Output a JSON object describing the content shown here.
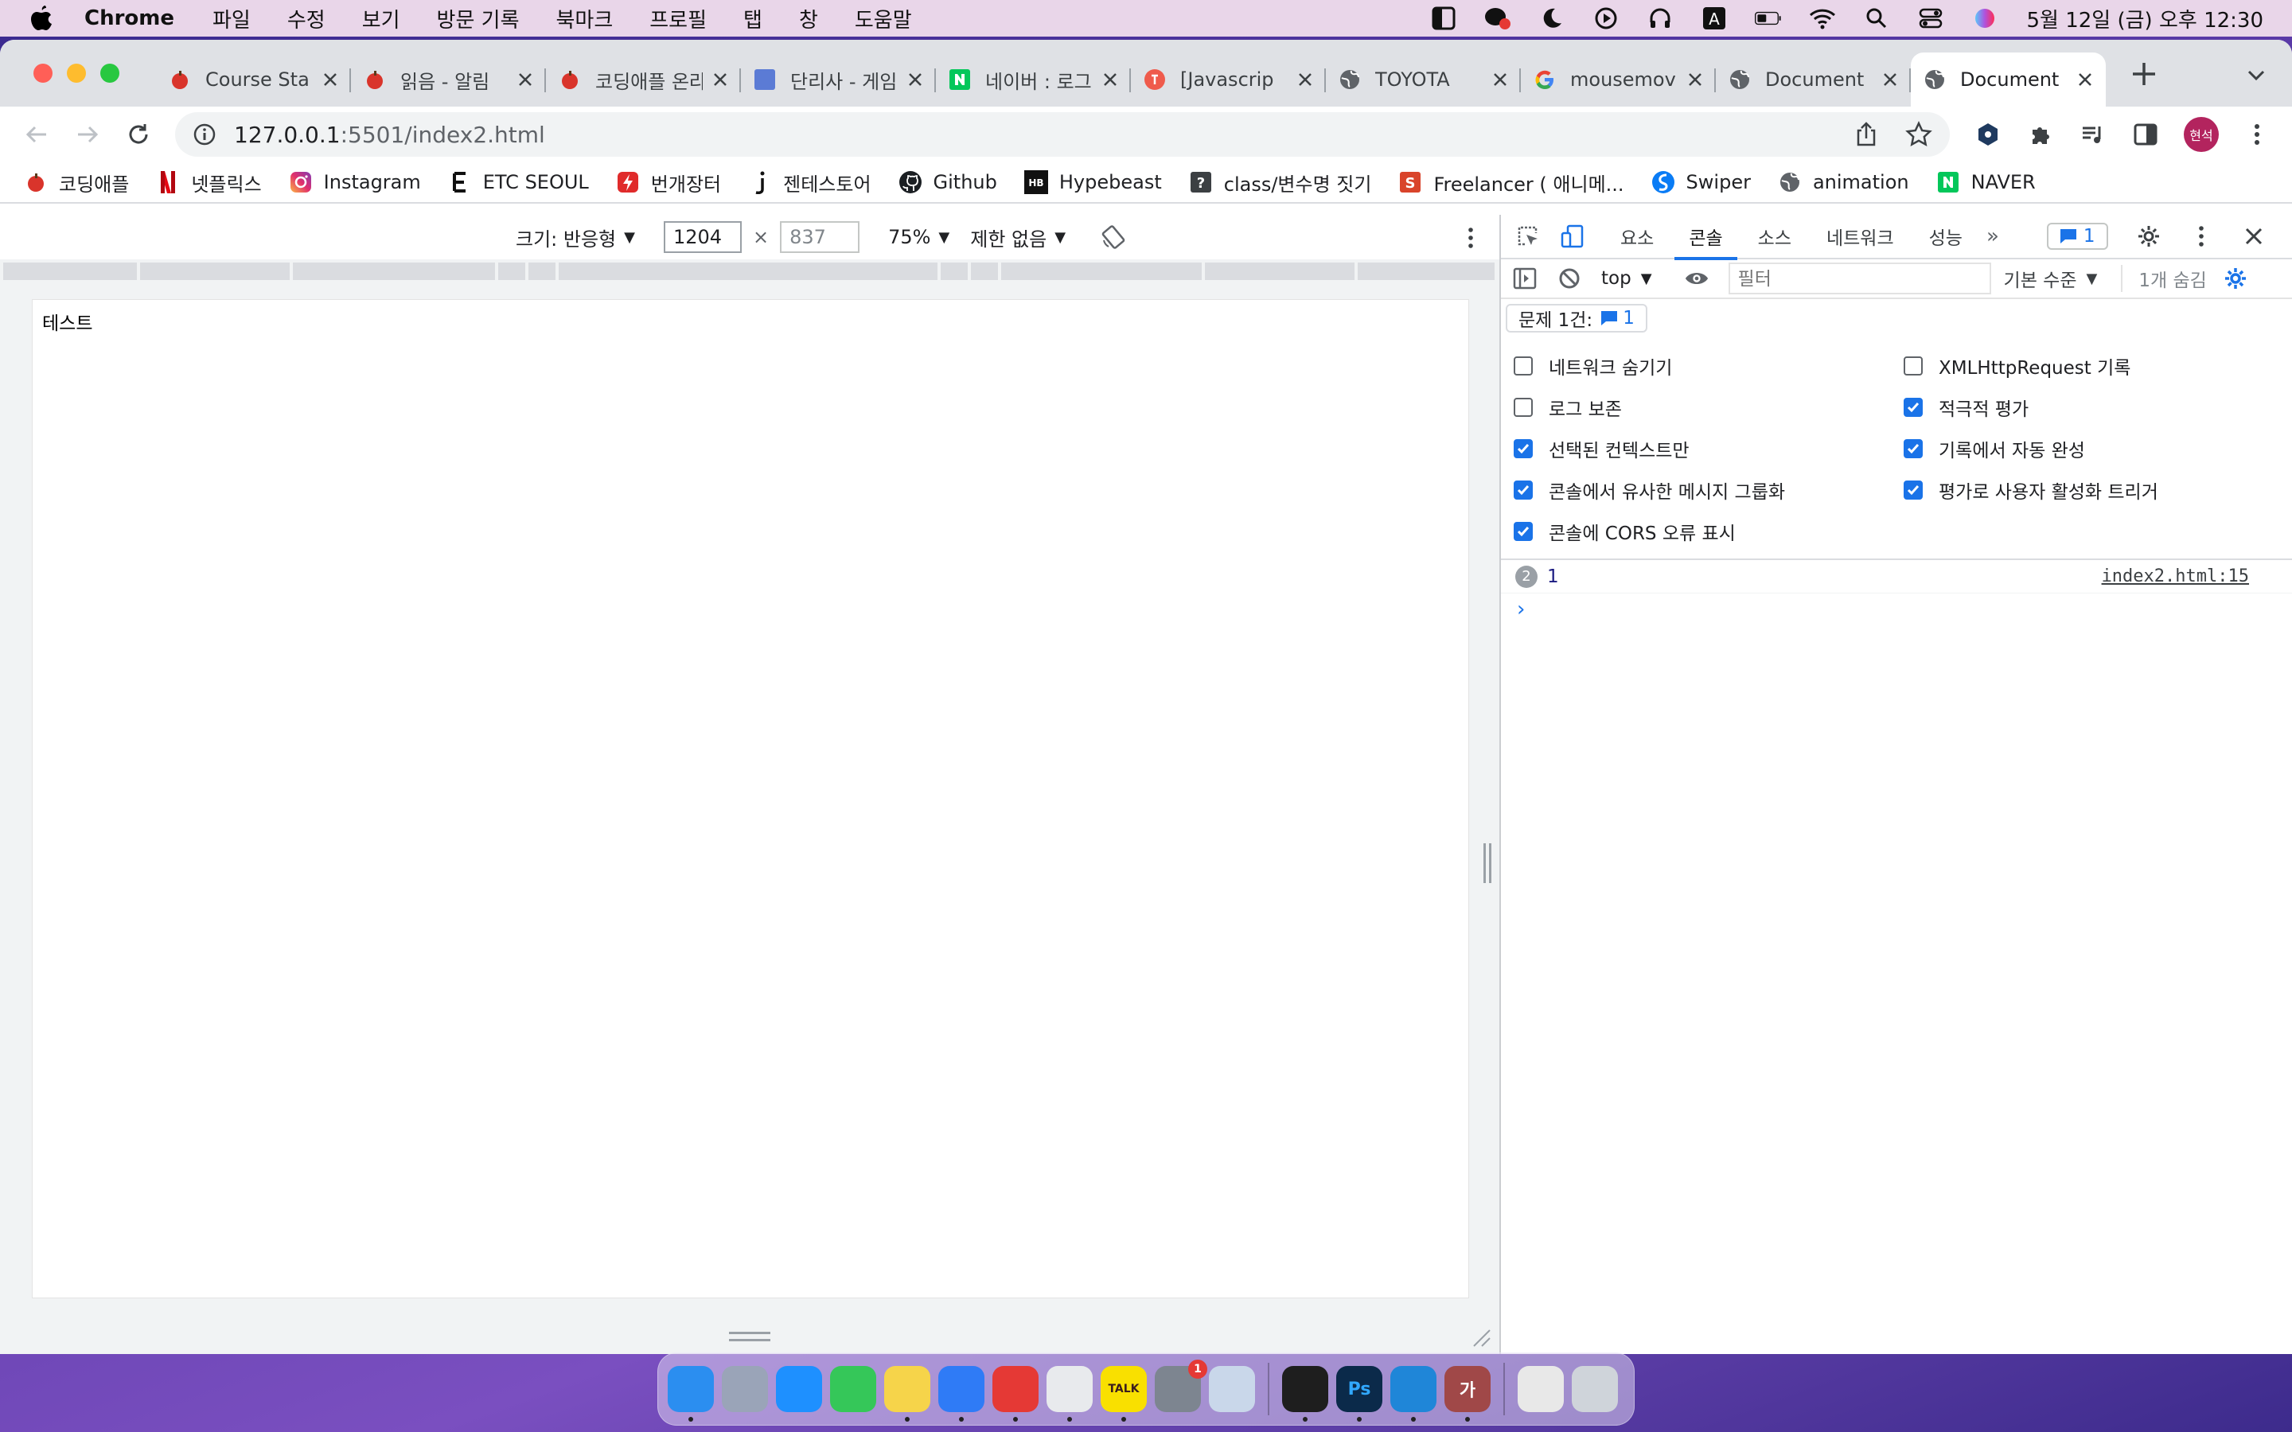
{
  "menubar": {
    "app_name": "Chrome",
    "menus": [
      "파일",
      "수정",
      "보기",
      "방문 기록",
      "북마크",
      "프로필",
      "탭",
      "창",
      "도움말"
    ],
    "clock": "5월 12일 (금) 오후 12:30"
  },
  "tabs": [
    {
      "title": "Course Sta",
      "icon": "apple-icon"
    },
    {
      "title": "읽음 - 알림",
      "icon": "apple-icon"
    },
    {
      "title": "코딩애플 온라",
      "icon": "apple-icon"
    },
    {
      "title": "단리사 - 게임",
      "icon": "dalisa-icon"
    },
    {
      "title": "네이버 : 로그",
      "icon": "naver-icon"
    },
    {
      "title": "[Javascrip",
      "icon": "velog-icon"
    },
    {
      "title": "TOYOTA",
      "icon": "globe-icon"
    },
    {
      "title": "mousemov",
      "icon": "google-icon"
    },
    {
      "title": "Document",
      "icon": "globe-icon"
    },
    {
      "title": "Document",
      "icon": "globe-icon",
      "active": true
    }
  ],
  "omnibox": {
    "host": "127.0.0.1",
    "path": ":5501/index2.html"
  },
  "profile_label": "현석",
  "bookmarks": [
    {
      "label": "코딩애플",
      "icon": "apple-icon"
    },
    {
      "label": "넷플릭스",
      "icon": "netflix-icon"
    },
    {
      "label": "Instagram",
      "icon": "instagram-icon"
    },
    {
      "label": "ETC SEOUL",
      "icon": "etc-icon"
    },
    {
      "label": "번개장터",
      "icon": "bunjang-icon"
    },
    {
      "label": "젠테스토어",
      "icon": "jente-icon"
    },
    {
      "label": "Github",
      "icon": "github-icon"
    },
    {
      "label": "Hypebeast",
      "icon": "hypebeast-icon"
    },
    {
      "label": "class/변수명 짓기",
      "icon": "question-icon"
    },
    {
      "label": "Freelancer ( 애니메...",
      "icon": "freelancer-icon"
    },
    {
      "label": "Swiper",
      "icon": "swiper-icon"
    },
    {
      "label": "animation",
      "icon": "globe-icon"
    },
    {
      "label": "NAVER",
      "icon": "naver-icon"
    }
  ],
  "device_toolbar": {
    "dimensions_label": "크기: 반응형",
    "width": "1204",
    "height": "837",
    "zoom": "75%",
    "throttle": "제한 없음"
  },
  "page": {
    "text": "테스트"
  },
  "devtools": {
    "tabs": [
      "요소",
      "콘솔",
      "소스",
      "네트워크",
      "성능"
    ],
    "active_tab": "콘솔",
    "issues_count": "1",
    "context": "top",
    "filter_placeholder": "필터",
    "levels": "기본 수준",
    "hidden": "1개 숨김",
    "issues_label": "문제 1건:",
    "issues_chip_count": "1",
    "settings_left": [
      {
        "label": "네트워크 숨기기",
        "checked": false
      },
      {
        "label": "로그 보존",
        "checked": false
      },
      {
        "label": "선택된 컨텍스트만",
        "checked": true
      },
      {
        "label": "콘솔에서 유사한 메시지 그룹화",
        "checked": true
      },
      {
        "label": "콘솔에 CORS 오류 표시",
        "checked": true
      }
    ],
    "settings_right": [
      {
        "label": "XMLHttpRequest 기록",
        "checked": false
      },
      {
        "label": "적극적 평가",
        "checked": true
      },
      {
        "label": "기록에서 자동 완성",
        "checked": true
      },
      {
        "label": "평가로 사용자 활성화 트리거",
        "checked": true
      }
    ],
    "log": {
      "repeat": "2",
      "message": "1",
      "source": "index2.html:15"
    }
  },
  "dock": [
    {
      "name": "finder",
      "color": "#2b8ef0",
      "running": true
    },
    {
      "name": "launchpad",
      "color": "#9aa4b8",
      "running": false
    },
    {
      "name": "app-store",
      "color": "#1e90ff",
      "running": false
    },
    {
      "name": "facetime",
      "color": "#35c759",
      "running": false
    },
    {
      "name": "notes",
      "color": "#f6d44a",
      "running": true
    },
    {
      "name": "safari",
      "color": "#2f7bf6",
      "running": true
    },
    {
      "name": "youtube-music",
      "color": "#e53935",
      "running": true
    },
    {
      "name": "chrome",
      "color": "#e8eaed",
      "running": true
    },
    {
      "name": "kakaotalk",
      "color": "#f9e000",
      "running": true,
      "label": "TALK"
    },
    {
      "name": "system-preferences",
      "color": "#7d8590",
      "running": false,
      "badge": "1"
    },
    {
      "name": "preview",
      "color": "#c9d7ea",
      "running": false
    },
    {
      "name": "terminal",
      "color": "#1e1e1e",
      "running": true
    },
    {
      "name": "photoshop",
      "color": "#0b2a4a",
      "running": true,
      "label": "Ps"
    },
    {
      "name": "vscode",
      "color": "#1f86d8",
      "running": true
    },
    {
      "name": "font-app",
      "color": "#a04848",
      "running": true,
      "label": "가"
    },
    {
      "name": "documents",
      "color": "#e8e8e8",
      "running": false
    },
    {
      "name": "trash",
      "color": "#cfd4da",
      "running": false
    }
  ]
}
